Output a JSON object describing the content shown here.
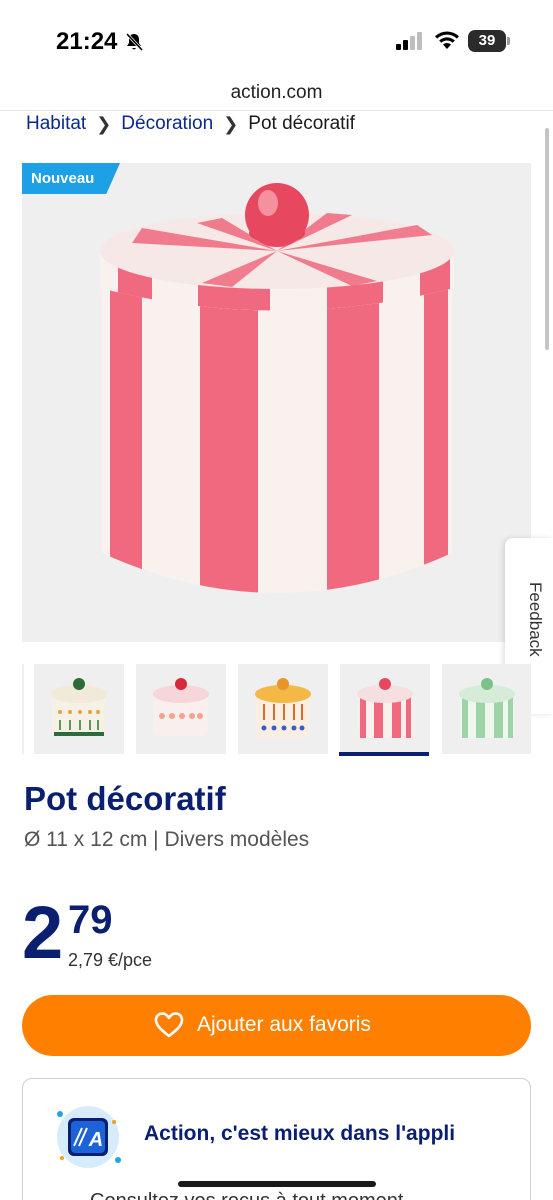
{
  "status_bar": {
    "time": "21:24",
    "battery": "39"
  },
  "browser": {
    "url": "action.com"
  },
  "breadcrumb": {
    "items": [
      "Habitat",
      "Décoration"
    ],
    "current": "Pot décoratif"
  },
  "product": {
    "badge": "Nouveau",
    "title": "Pot décoratif",
    "subtitle": "Ø 11 x 12 cm | Divers modèles",
    "price_whole": "2",
    "price_cents": "79",
    "price_unit": "2,79 €/pce",
    "selected_thumbnail": 4
  },
  "actions": {
    "favorite_label": "Ajouter aux favoris"
  },
  "app_promo": {
    "text": "Action, c'est mieux dans l'appli",
    "bullet": "Consultez vos reçus à tout moment"
  },
  "feedback": {
    "label": "Feedback"
  },
  "colors": {
    "brand_blue": "#0a1f70",
    "accent_orange": "#ff8000",
    "badge_blue": "#1ea0e6",
    "stripe_pink": "#f0697e"
  }
}
